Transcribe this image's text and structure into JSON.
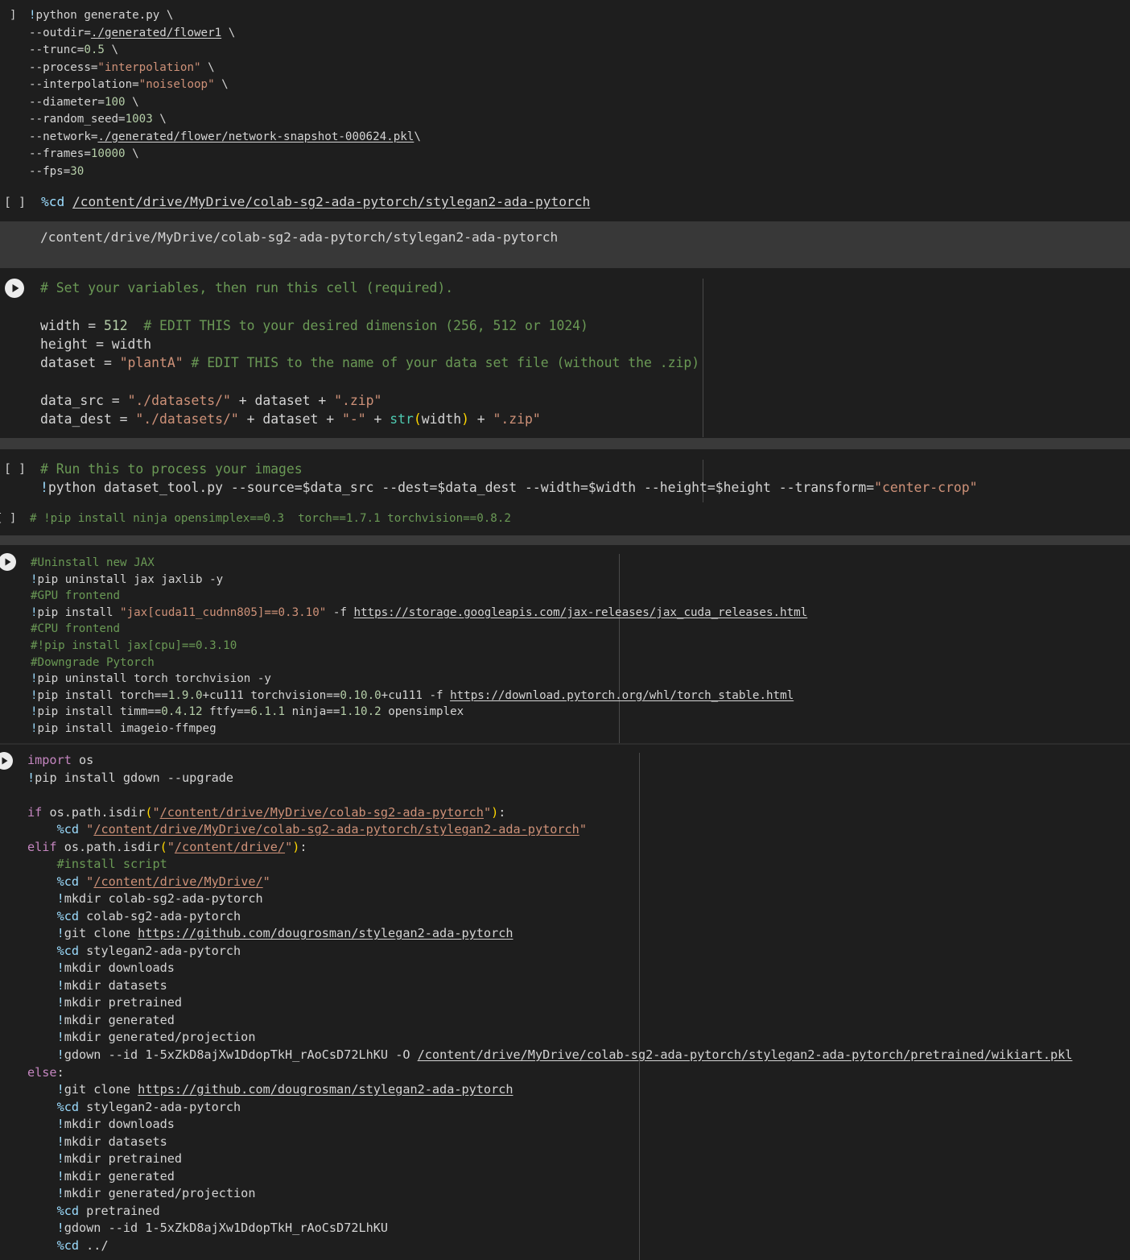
{
  "cells": [
    {
      "id": "generate",
      "gutter": "]",
      "lines": [
        [
          [
            "mg",
            "!"
          ],
          [
            "pl",
            "python generate.py \\"
          ]
        ],
        [
          [
            "pl",
            "--outdir="
          ],
          [
            "u",
            "./generated/flower1"
          ],
          [
            "pl",
            " \\"
          ]
        ],
        [
          [
            "pl",
            "--trunc="
          ],
          [
            "num",
            "0.5"
          ],
          [
            "pl",
            " \\"
          ]
        ],
        [
          [
            "pl",
            "--process="
          ],
          [
            "str",
            "\"interpolation\""
          ],
          [
            "pl",
            " \\"
          ]
        ],
        [
          [
            "pl",
            "--interpolation="
          ],
          [
            "str",
            "\"noiseloop\""
          ],
          [
            "pl",
            " \\"
          ]
        ],
        [
          [
            "pl",
            "--diameter="
          ],
          [
            "num",
            "100"
          ],
          [
            "pl",
            " \\"
          ]
        ],
        [
          [
            "pl",
            "--random_seed="
          ],
          [
            "num",
            "1003"
          ],
          [
            "pl",
            " \\"
          ]
        ],
        [
          [
            "pl",
            "--network="
          ],
          [
            "u",
            "./generated/flower/network-snapshot-000624.pkl"
          ],
          [
            "pl",
            "\\"
          ]
        ],
        [
          [
            "pl",
            "--frames="
          ],
          [
            "num",
            "10000"
          ],
          [
            "pl",
            " \\"
          ]
        ],
        [
          [
            "pl",
            "--fps="
          ],
          [
            "num",
            "30"
          ]
        ]
      ]
    },
    {
      "id": "cd-cell",
      "gutter": "[ ]",
      "lines": [
        [
          [
            "mg",
            "%cd"
          ],
          [
            "pl",
            " "
          ],
          [
            "u",
            "/content/drive/MyDrive/colab-sg2-ada-pytorch/stylegan2-ada-pytorch"
          ]
        ]
      ]
    },
    {
      "id": "cd-output",
      "lines": [
        [
          [
            "pl",
            "/content/drive/MyDrive/colab-sg2-ada-pytorch/stylegan2-ada-pytorch"
          ]
        ]
      ]
    },
    {
      "id": "variables",
      "run_button": true,
      "lines": [
        [
          [
            "cm",
            "# Set your variables, then run this cell (required)."
          ]
        ],
        [],
        [
          [
            "pl",
            "width = "
          ],
          [
            "num",
            "512"
          ],
          [
            "pl",
            "  "
          ],
          [
            "cm",
            "# EDIT THIS to your desired dimension (256, 512 or 1024)"
          ]
        ],
        [
          [
            "pl",
            "height = width"
          ]
        ],
        [
          [
            "pl",
            "dataset = "
          ],
          [
            "str",
            "\"plantA\""
          ],
          [
            "pl",
            " "
          ],
          [
            "cm",
            "# EDIT THIS to the name of your data set file (without the .zip)"
          ]
        ],
        [],
        [
          [
            "pl",
            "data_src = "
          ],
          [
            "str",
            "\"./datasets/\""
          ],
          [
            "pl",
            " + dataset + "
          ],
          [
            "str",
            "\".zip\""
          ]
        ],
        [
          [
            "pl",
            "data_dest = "
          ],
          [
            "str",
            "\"./datasets/\""
          ],
          [
            "pl",
            " + dataset + "
          ],
          [
            "str",
            "\"-\""
          ],
          [
            "pl",
            " + "
          ],
          [
            "fn",
            "str"
          ],
          [
            "par",
            "("
          ],
          [
            "pl",
            "width"
          ],
          [
            "par",
            ")"
          ],
          [
            "pl",
            " + "
          ],
          [
            "str",
            "\".zip\""
          ]
        ]
      ]
    },
    {
      "id": "process-images",
      "gutter": "[ ]",
      "lines": [
        [
          [
            "cm",
            "# Run this to process your images"
          ]
        ],
        [
          [
            "mg",
            "!"
          ],
          [
            "pl",
            "python dataset_tool.py --source=$data_src --dest=$data_dest --width=$width --height=$height --transform="
          ],
          [
            "str",
            "\"center-crop\""
          ]
        ]
      ]
    },
    {
      "id": "pip-comment",
      "gutter": "[ ]",
      "lines": [
        [
          [
            "cm",
            "# !pip install ninja opensimplex==0.3  torch==1.7.1 torchvision==0.8.2"
          ]
        ]
      ]
    },
    {
      "id": "jax-cell",
      "run_button": true,
      "lines": [
        [
          [
            "cm",
            "#Uninstall new JAX"
          ]
        ],
        [
          [
            "mg",
            "!"
          ],
          [
            "pl",
            "pip uninstall jax jaxlib -y"
          ]
        ],
        [
          [
            "cm",
            "#GPU frontend"
          ]
        ],
        [
          [
            "mg",
            "!"
          ],
          [
            "pl",
            "pip install "
          ],
          [
            "str",
            "\"jax[cuda11_cudnn805]==0.3.10\""
          ],
          [
            "pl",
            " -f "
          ],
          [
            "u",
            "https://storage.googleapis.com/jax-releases/jax_cuda_releases.html"
          ]
        ],
        [
          [
            "cm",
            "#CPU frontend"
          ]
        ],
        [
          [
            "cm",
            "#!pip install jax[cpu]==0.3.10"
          ]
        ],
        [
          [
            "cm",
            "#Downgrade Pytorch"
          ]
        ],
        [
          [
            "mg",
            "!"
          ],
          [
            "pl",
            "pip uninstall torch torchvision -y"
          ]
        ],
        [
          [
            "mg",
            "!"
          ],
          [
            "pl",
            "pip install torch=="
          ],
          [
            "num",
            "1.9.0"
          ],
          [
            "pl",
            "+cu111 torchvision=="
          ],
          [
            "num",
            "0.10.0"
          ],
          [
            "pl",
            "+cu111 -f "
          ],
          [
            "u",
            "https://download.pytorch.org/whl/torch_stable.html"
          ]
        ],
        [
          [
            "mg",
            "!"
          ],
          [
            "pl",
            "pip install timm=="
          ],
          [
            "num",
            "0.4.12"
          ],
          [
            "pl",
            " ftfy=="
          ],
          [
            "num",
            "6.1.1"
          ],
          [
            "pl",
            " ninja=="
          ],
          [
            "num",
            "1.10.2"
          ],
          [
            "pl",
            " opensimplex"
          ]
        ],
        [
          [
            "mg",
            "!"
          ],
          [
            "pl",
            "pip install imageio-ffmpeg"
          ]
        ]
      ]
    },
    {
      "id": "setup-cell",
      "run_button": true,
      "lines": [
        [
          [
            "kw",
            "import"
          ],
          [
            "pl",
            " os"
          ]
        ],
        [
          [
            "mg",
            "!"
          ],
          [
            "pl",
            "pip install gdown --upgrade"
          ]
        ],
        [],
        [
          [
            "kw",
            "if"
          ],
          [
            "pl",
            " os.path.isdir"
          ],
          [
            "par",
            "("
          ],
          [
            "str",
            "\""
          ],
          [
            "str u",
            "/content/drive/MyDrive/colab-sg2-ada-pytorch"
          ],
          [
            "str",
            "\""
          ],
          [
            "par",
            ")"
          ],
          [
            "pl",
            ":"
          ]
        ],
        [
          [
            "pl",
            "    "
          ],
          [
            "mg",
            "%cd"
          ],
          [
            "pl",
            " "
          ],
          [
            "str",
            "\""
          ],
          [
            "str u",
            "/content/drive/MyDrive/colab-sg2-ada-pytorch/stylegan2-ada-pytorch"
          ],
          [
            "str",
            "\""
          ]
        ],
        [
          [
            "kw",
            "elif"
          ],
          [
            "pl",
            " os.path.isdir"
          ],
          [
            "par",
            "("
          ],
          [
            "str",
            "\""
          ],
          [
            "str u",
            "/content/drive/"
          ],
          [
            "str",
            "\""
          ],
          [
            "par",
            ")"
          ],
          [
            "pl",
            ":"
          ]
        ],
        [
          [
            "pl",
            "    "
          ],
          [
            "cm",
            "#install script"
          ]
        ],
        [
          [
            "pl",
            "    "
          ],
          [
            "mg",
            "%cd"
          ],
          [
            "pl",
            " "
          ],
          [
            "str",
            "\""
          ],
          [
            "str u",
            "/content/drive/MyDrive/"
          ],
          [
            "str",
            "\""
          ]
        ],
        [
          [
            "pl",
            "    "
          ],
          [
            "mg",
            "!"
          ],
          [
            "pl",
            "mkdir colab-sg2-ada-pytorch"
          ]
        ],
        [
          [
            "pl",
            "    "
          ],
          [
            "mg",
            "%cd"
          ],
          [
            "pl",
            " colab-sg2-ada-pytorch"
          ]
        ],
        [
          [
            "pl",
            "    "
          ],
          [
            "mg",
            "!"
          ],
          [
            "pl",
            "git clone "
          ],
          [
            "u",
            "https://github.com/dougrosman/stylegan2-ada-pytorch"
          ]
        ],
        [
          [
            "pl",
            "    "
          ],
          [
            "mg",
            "%cd"
          ],
          [
            "pl",
            " stylegan2-ada-pytorch"
          ]
        ],
        [
          [
            "pl",
            "    "
          ],
          [
            "mg",
            "!"
          ],
          [
            "pl",
            "mkdir downloads"
          ]
        ],
        [
          [
            "pl",
            "    "
          ],
          [
            "mg",
            "!"
          ],
          [
            "pl",
            "mkdir datasets"
          ]
        ],
        [
          [
            "pl",
            "    "
          ],
          [
            "mg",
            "!"
          ],
          [
            "pl",
            "mkdir pretrained"
          ]
        ],
        [
          [
            "pl",
            "    "
          ],
          [
            "mg",
            "!"
          ],
          [
            "pl",
            "mkdir generated"
          ]
        ],
        [
          [
            "pl",
            "    "
          ],
          [
            "mg",
            "!"
          ],
          [
            "pl",
            "mkdir generated/projection"
          ]
        ],
        [
          [
            "pl",
            "    "
          ],
          [
            "mg",
            "!"
          ],
          [
            "pl",
            "gdown --id 1-5xZkD8ajXw1DdopTkH_rAoCsD72LhKU -O "
          ],
          [
            "u",
            "/content/drive/MyDrive/colab-sg2-ada-pytorch/stylegan2-ada-pytorch/pretrained/wikiart.pkl"
          ]
        ],
        [
          [
            "kw",
            "else"
          ],
          [
            "pl",
            ":"
          ]
        ],
        [
          [
            "pl",
            "    "
          ],
          [
            "mg",
            "!"
          ],
          [
            "pl",
            "git clone "
          ],
          [
            "u",
            "https://github.com/dougrosman/stylegan2-ada-pytorch"
          ]
        ],
        [
          [
            "pl",
            "    "
          ],
          [
            "mg",
            "%cd"
          ],
          [
            "pl",
            " stylegan2-ada-pytorch"
          ]
        ],
        [
          [
            "pl",
            "    "
          ],
          [
            "mg",
            "!"
          ],
          [
            "pl",
            "mkdir downloads"
          ]
        ],
        [
          [
            "pl",
            "    "
          ],
          [
            "mg",
            "!"
          ],
          [
            "pl",
            "mkdir datasets"
          ]
        ],
        [
          [
            "pl",
            "    "
          ],
          [
            "mg",
            "!"
          ],
          [
            "pl",
            "mkdir pretrained"
          ]
        ],
        [
          [
            "pl",
            "    "
          ],
          [
            "mg",
            "!"
          ],
          [
            "pl",
            "mkdir generated"
          ]
        ],
        [
          [
            "pl",
            "    "
          ],
          [
            "mg",
            "!"
          ],
          [
            "pl",
            "mkdir generated/projection"
          ]
        ],
        [
          [
            "pl",
            "    "
          ],
          [
            "mg",
            "%cd"
          ],
          [
            "pl",
            " pretrained"
          ]
        ],
        [
          [
            "pl",
            "    "
          ],
          [
            "mg",
            "!"
          ],
          [
            "pl",
            "gdown --id 1-5xZkD8ajXw1DdopTkH_rAoCsD72LhKU"
          ]
        ],
        [
          [
            "pl",
            "    "
          ],
          [
            "mg",
            "%cd"
          ],
          [
            "pl",
            " ../"
          ]
        ]
      ]
    }
  ]
}
